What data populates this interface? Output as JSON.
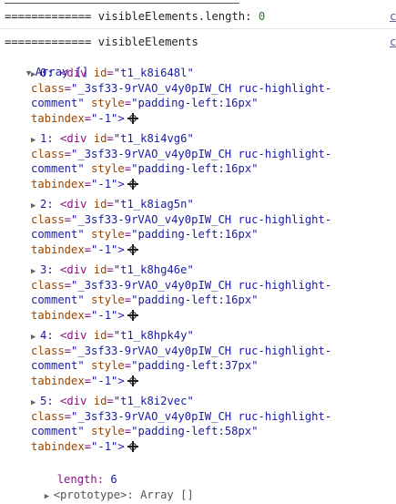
{
  "console": {
    "line1": {
      "label": "============= visibleElements.length: ",
      "value": "0",
      "link": "c"
    },
    "line2": {
      "label": "============= visibleElements",
      "link": "c"
    },
    "array_header": "Array []",
    "items": [
      {
        "index": "0:",
        "id": "t1_k8i648l",
        "cls_a": "_3sf33-9rVAO_v4y0pIW_CH ruc-highlight-",
        "cls_b": "comment",
        "style": "padding-left:16px"
      },
      {
        "index": "1:",
        "id": "t1_k8i4vg6",
        "cls_a": "_3sf33-9rVAO_v4y0pIW_CH ruc-highlight-",
        "cls_b": "comment",
        "style": "padding-left:16px"
      },
      {
        "index": "2:",
        "id": "t1_k8iag5n",
        "cls_a": "_3sf33-9rVAO_v4y0pIW_CH ruc-highlight-",
        "cls_b": "comment",
        "style": "padding-left:16px"
      },
      {
        "index": "3:",
        "id": "t1_k8hg46e",
        "cls_a": "_3sf33-9rVAO_v4y0pIW_CH ruc-highlight-",
        "cls_b": "comment",
        "style": "padding-left:16px"
      },
      {
        "index": "4:",
        "id": "t1_k8hpk4y",
        "cls_a": "_3sf33-9rVAO_v4y0pIW_CH ruc-highlight-",
        "cls_b": "comment",
        "style": "padding-left:37px"
      },
      {
        "index": "5:",
        "id": "t1_k8i2vec",
        "cls_a": "_3sf33-9rVAO_v4y0pIW_CH ruc-highlight-",
        "cls_b": "comment",
        "style": "padding-left:58px"
      }
    ],
    "tabindex_val": "\"-1\">",
    "length_key": "length:",
    "length_val": "6",
    "prototype": "<prototype>: Array []"
  }
}
